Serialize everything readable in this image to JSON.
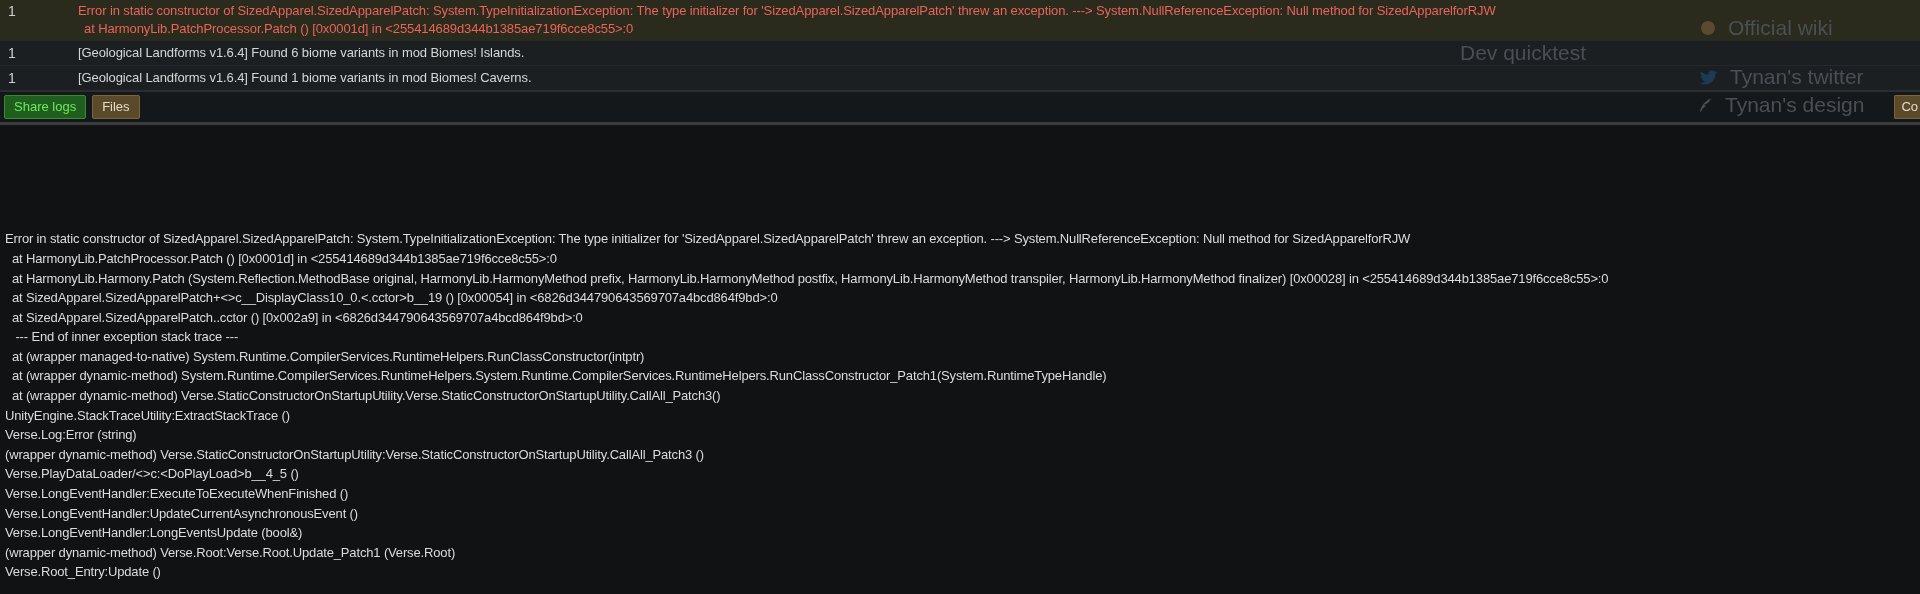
{
  "messages": [
    {
      "count": "1",
      "kind": "error",
      "selected": true,
      "lines": [
        "Error in static constructor of SizedApparel.SizedApparelPatch: System.TypeInitializationException: The type initializer for 'SizedApparel.SizedApparelPatch' threw an exception. ---> System.NullReferenceException: Null method for SizedApparelforRJW",
        "at HarmonyLib.PatchProcessor.Patch () [0x0001d] in <255414689d344b1385ae719f6cce8c55>:0"
      ]
    },
    {
      "count": "1",
      "kind": "info",
      "selected": false,
      "lines": [
        "[Geological Landforms v1.6.4] Found 6 biome variants in mod Biomes! Islands."
      ]
    },
    {
      "count": "1",
      "kind": "info",
      "selected": false,
      "lines": [
        "[Geological Landforms v1.6.4] Found 1 biome variants in mod Biomes! Caverns."
      ]
    }
  ],
  "buttons": [
    {
      "label": "Share logs",
      "kind": "share"
    },
    {
      "label": "Files",
      "kind": "normal"
    }
  ],
  "cut_button": {
    "label": "Co"
  },
  "background_menu": [
    {
      "label": "Official wiki"
    },
    {
      "label": "Dev quicktest"
    },
    {
      "label": "Tynan's twitter"
    },
    {
      "label": "Tynan's design"
    }
  ],
  "details": {
    "lines": [
      "Error in static constructor of SizedApparel.SizedApparelPatch: System.TypeInitializationException: The type initializer for 'SizedApparel.SizedApparelPatch' threw an exception. ---> System.NullReferenceException: Null method for SizedApparelforRJW",
      "  at HarmonyLib.PatchProcessor.Patch () [0x0001d] in <255414689d344b1385ae719f6cce8c55>:0",
      "  at HarmonyLib.Harmony.Patch (System.Reflection.MethodBase original, HarmonyLib.HarmonyMethod prefix, HarmonyLib.HarmonyMethod postfix, HarmonyLib.HarmonyMethod transpiler, HarmonyLib.HarmonyMethod finalizer) [0x00028] in <255414689d344b1385ae719f6cce8c55>:0",
      "  at SizedApparel.SizedApparelPatch+<>c__DisplayClass10_0.<.cctor>b__19 () [0x00054] in <6826d344790643569707a4bcd864f9bd>:0",
      "  at SizedApparel.SizedApparelPatch..cctor () [0x002a9] in <6826d344790643569707a4bcd864f9bd>:0",
      "   --- End of inner exception stack trace ---",
      "  at (wrapper managed-to-native) System.Runtime.CompilerServices.RuntimeHelpers.RunClassConstructor(intptr)",
      "  at (wrapper dynamic-method) System.Runtime.CompilerServices.RuntimeHelpers.System.Runtime.CompilerServices.RuntimeHelpers.RunClassConstructor_Patch1(System.RuntimeTypeHandle)",
      "  at (wrapper dynamic-method) Verse.StaticConstructorOnStartupUtility.Verse.StaticConstructorOnStartupUtility.CallAll_Patch3()",
      "UnityEngine.StackTraceUtility:ExtractStackTrace ()",
      "Verse.Log:Error (string)",
      "(wrapper dynamic-method) Verse.StaticConstructorOnStartupUtility:Verse.StaticConstructorOnStartupUtility.CallAll_Patch3 ()",
      "Verse.PlayDataLoader/<>c:<DoPlayLoad>b__4_5 ()",
      "Verse.LongEventHandler:ExecuteToExecuteWhenFinished ()",
      "Verse.LongEventHandler:UpdateCurrentAsynchronousEvent ()",
      "Verse.LongEventHandler:LongEventsUpdate (bool&)",
      "(wrapper dynamic-method) Verse.Root:Verse.Root.Update_Patch1 (Verse.Root)",
      "Verse.Root_Entry:Update ()"
    ]
  }
}
